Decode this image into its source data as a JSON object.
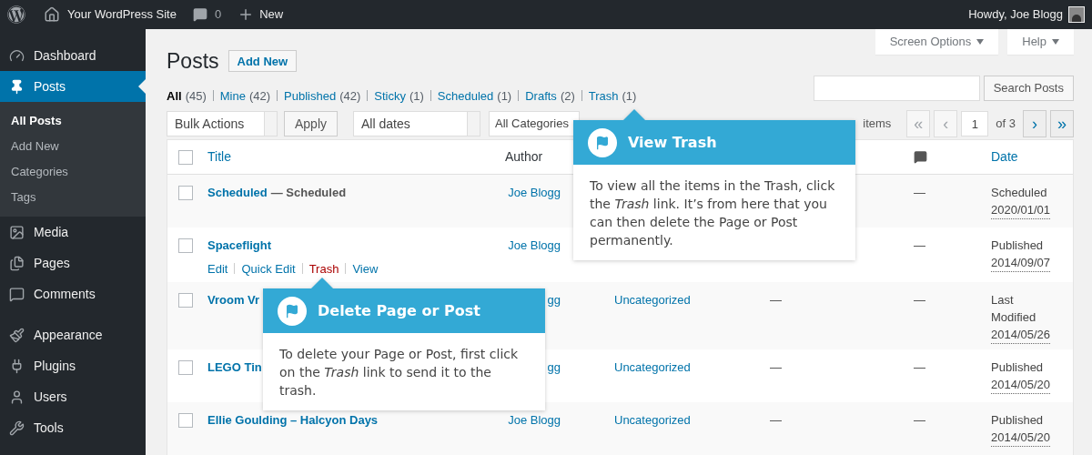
{
  "admin_bar": {
    "site_name": "Your WordPress Site",
    "comments_count": "0",
    "new_label": "New",
    "greeting": "Howdy, Joe Blogg"
  },
  "sidebar": {
    "groups": [
      [
        {
          "label": "Dashboard",
          "selected": false
        },
        {
          "label": "Posts",
          "selected": true,
          "children": [
            {
              "label": "All Posts",
              "selected": true
            },
            {
              "label": "Add New",
              "selected": false
            },
            {
              "label": "Categories",
              "selected": false
            },
            {
              "label": "Tags",
              "selected": false
            }
          ]
        },
        {
          "label": "Media",
          "selected": false
        },
        {
          "label": "Pages",
          "selected": false
        },
        {
          "label": "Comments",
          "selected": false
        }
      ],
      [
        {
          "label": "Appearance",
          "selected": false
        },
        {
          "label": "Plugins",
          "selected": false
        },
        {
          "label": "Users",
          "selected": false
        },
        {
          "label": "Tools",
          "selected": false
        }
      ]
    ]
  },
  "screen_tabs": [
    "Screen Options",
    "Help"
  ],
  "page_title": "Posts",
  "add_new": "Add New",
  "filters": [
    {
      "label": "All",
      "count": "(45)",
      "selected": true
    },
    {
      "label": "Mine",
      "count": "(42)",
      "selected": false
    },
    {
      "label": "Published",
      "count": "(42)",
      "selected": false
    },
    {
      "label": "Sticky",
      "count": "(1)",
      "selected": false
    },
    {
      "label": "Scheduled",
      "count": "(1)",
      "selected": false
    },
    {
      "label": "Drafts",
      "count": "(2)",
      "selected": false
    },
    {
      "label": "Trash",
      "count": "(1)",
      "selected": false
    }
  ],
  "search_button": "Search Posts",
  "bulk_actions": "Bulk Actions",
  "apply": "Apply",
  "dates_filter": "All dates",
  "categories_filter": "All Categories",
  "pagination": {
    "items_count": "items",
    "first": {
      "label": "«",
      "disabled": true
    },
    "prev": {
      "label": "‹",
      "disabled": true
    },
    "page": "1",
    "of": "of 3",
    "next": {
      "label": "›",
      "disabled": false
    },
    "last": {
      "label": "»",
      "disabled": false
    }
  },
  "table": {
    "columns": {
      "title": "Title",
      "author": "Author",
      "date": "Date"
    },
    "select_all_checked": false,
    "rows": [
      {
        "checked": false,
        "title": "Scheduled",
        "post_state": "— Scheduled",
        "author": "Joe Blogg",
        "comments": "—",
        "date_status": "Scheduled",
        "date": "2020/01/01"
      },
      {
        "checked": false,
        "title": "Spaceflight",
        "actions": [
          {
            "label": "Edit",
            "kind": "normal"
          },
          {
            "label": "Quick Edit",
            "kind": "normal"
          },
          {
            "label": "Trash",
            "kind": "delete"
          },
          {
            "label": "View",
            "kind": "normal"
          }
        ],
        "author": "Joe Blogg",
        "comments": "—",
        "date_status": "Published",
        "date": "2014/09/07"
      },
      {
        "checked": false,
        "title": "Vroom Vr",
        "author": "gg",
        "categories": "Uncategorized",
        "tags": "—",
        "comments": "—",
        "date_status": "Last Modified",
        "date": "2014/05/26"
      },
      {
        "checked": false,
        "title": "LEGO Tin",
        "author": "gg",
        "categories": "Uncategorized",
        "tags": "—",
        "comments": "—",
        "date_status": "Published",
        "date": "2014/05/20"
      },
      {
        "checked": false,
        "title": "Ellie Goulding – Halcyon Days",
        "author": "Joe Blogg",
        "categories": "Uncategorized",
        "tags": "—",
        "comments": "—",
        "date_status": "Published",
        "date": "2014/05/20"
      }
    ]
  },
  "popovers": [
    {
      "title": "View Trash",
      "text": "To view all the items in the Trash, click the *Trash* link. It’s from here that you can then delete the Page or Post permanently."
    },
    {
      "title": "Delete Page or Post",
      "text": "To delete your Page or Post, first click on the *Trash* link to send it to the trash."
    }
  ]
}
